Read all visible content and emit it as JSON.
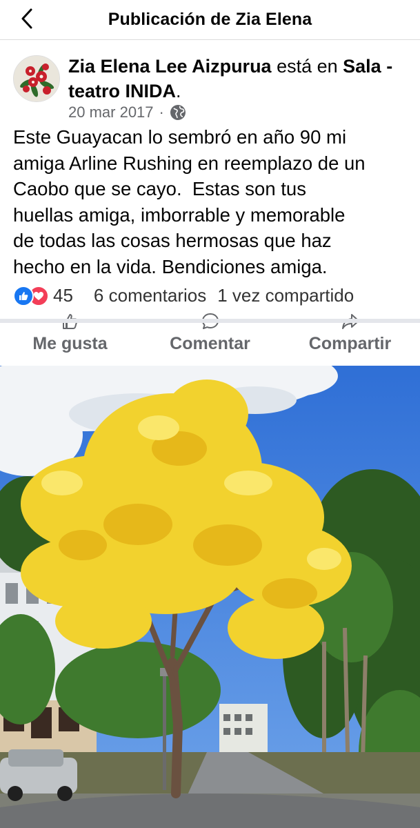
{
  "header": {
    "title": "Publicación de Zia Elena",
    "back_icon": "chevron-left-icon"
  },
  "post": {
    "author": "Zia Elena Lee Aizpurua",
    "connector": " está en ",
    "place": "Sala - teatro INIDA",
    "place_suffix": ".",
    "date": "20 mar 2017",
    "separator": "·",
    "privacy_icon": "globe-icon",
    "text": "Este Guayacan lo sembró en año 90 mi\namiga Arline Rushing en reemplazo de un\nCaobo que se cayo.  Estas son tus\nhuellas amiga, imborrable y memorable\nde todas las cosas hermosas que haz\nhecho en la vida. Bendiciones amiga."
  },
  "stats": {
    "reaction_count": "45",
    "comments": "6 comentarios",
    "shares": "1 vez compartido",
    "reaction_icons": [
      "like-icon",
      "love-icon"
    ]
  },
  "actions": {
    "like": "Me gusta",
    "comment": "Comentar",
    "share": "Compartir"
  },
  "colors": {
    "like_blue": "#1877f2",
    "love_red": "#f33e58",
    "secondary_text": "#65676b",
    "tree_yellow": "#f2d22e"
  }
}
